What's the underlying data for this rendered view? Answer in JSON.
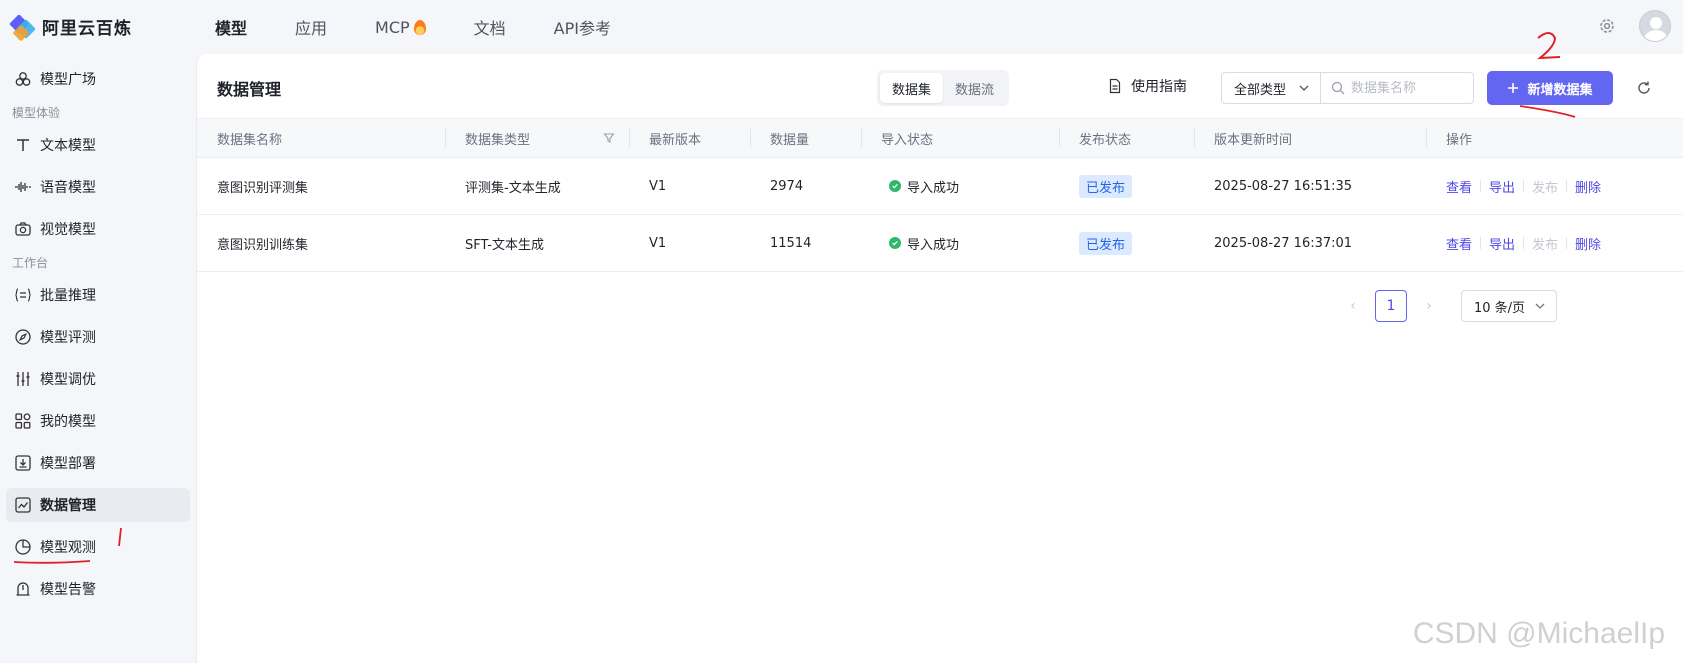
{
  "app": {
    "name": "阿里云百炼"
  },
  "topnav": [
    {
      "label": "模型",
      "active": true
    },
    {
      "label": "应用",
      "active": false
    },
    {
      "label": "MCP",
      "active": false,
      "icon": "flame-icon"
    },
    {
      "label": "文档",
      "active": false
    },
    {
      "label": "API参考",
      "active": false
    }
  ],
  "sidebar": {
    "items_top": [
      {
        "label": "模型广场",
        "icon": "plaza-icon"
      }
    ],
    "group1": "模型体验",
    "items_exp": [
      {
        "label": "文本模型",
        "icon": "text-icon"
      },
      {
        "label": "语音模型",
        "icon": "waveform-icon"
      },
      {
        "label": "视觉模型",
        "icon": "camera-icon"
      }
    ],
    "group2": "工作台",
    "items_work": [
      {
        "label": "批量推理",
        "icon": "batch-icon"
      },
      {
        "label": "模型评测",
        "icon": "compass-icon"
      },
      {
        "label": "模型调优",
        "icon": "sliders-icon"
      },
      {
        "label": "我的模型",
        "icon": "grid-icon"
      },
      {
        "label": "模型部署",
        "icon": "deploy-icon"
      },
      {
        "label": "数据管理",
        "icon": "chart-icon",
        "active": true
      },
      {
        "label": "模型观测",
        "icon": "pie-icon"
      },
      {
        "label": "模型告警",
        "icon": "alarm-icon"
      }
    ]
  },
  "page": {
    "title": "数据管理",
    "tabs": [
      "数据集",
      "数据流"
    ],
    "guide": "使用指南",
    "type_filter": "全部类型",
    "search_placeholder": "数据集名称",
    "add_button": "新增数据集"
  },
  "table": {
    "columns": [
      "数据集名称",
      "数据集类型",
      "最新版本",
      "数据量",
      "导入状态",
      "发布状态",
      "版本更新时间",
      "操作"
    ],
    "rows": [
      {
        "name": "意图识别评测集",
        "type": "评测集-文本生成",
        "version": "V1",
        "count": "2974",
        "import": "导入成功",
        "publish": "已发布",
        "updated": "2025-08-27 16:51:35"
      },
      {
        "name": "意图识别训练集",
        "type": "SFT-文本生成",
        "version": "V1",
        "count": "11514",
        "import": "导入成功",
        "publish": "已发布",
        "updated": "2025-08-27 16:37:01"
      }
    ],
    "actions": [
      "查看",
      "导出",
      "发布",
      "删除"
    ]
  },
  "pagination": {
    "current": "1",
    "page_size": "10 条/页"
  },
  "watermark": "CSDN @MichaelIp",
  "colors": {
    "primary": "#6366f1",
    "success": "#2eb86b",
    "badge_bg": "#dbeafe",
    "annotation": "#e0202a"
  }
}
